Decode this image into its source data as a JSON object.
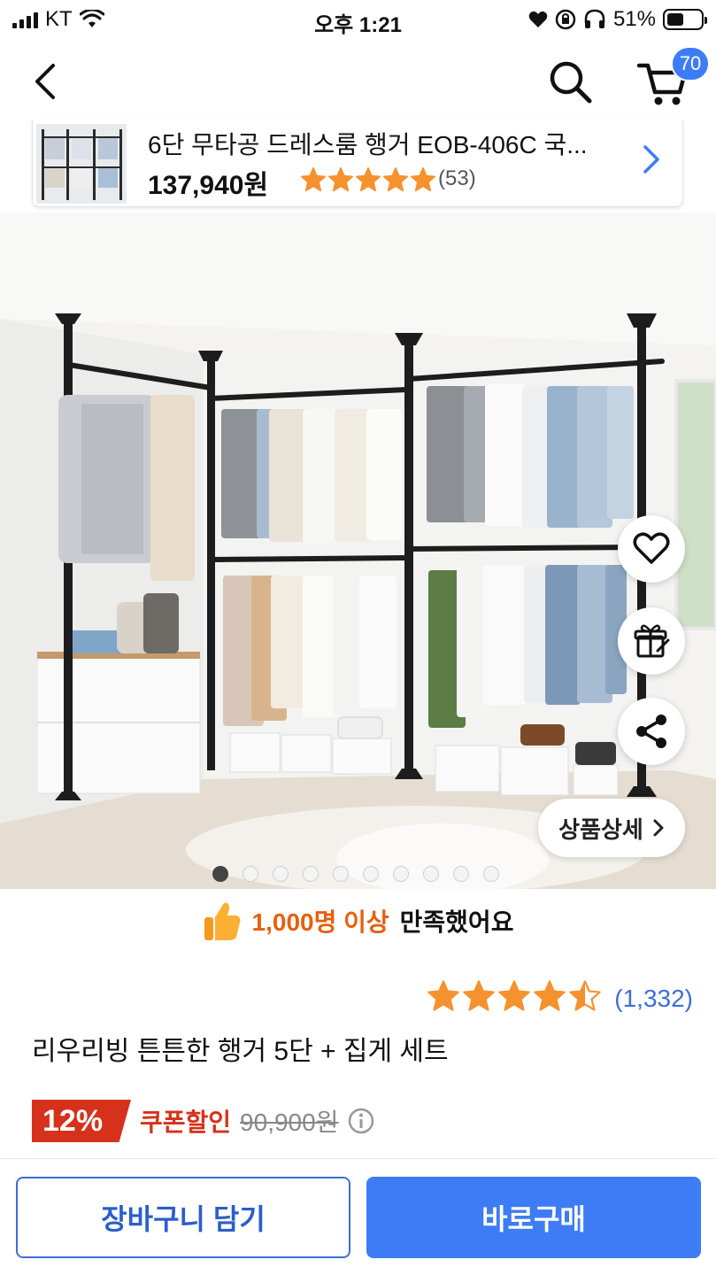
{
  "status_bar": {
    "carrier": "KT",
    "time": "오후 1:21",
    "battery_percent": "51%",
    "battery_level": 0.51
  },
  "header": {
    "back_icon": "chevron-left-icon",
    "search_icon": "search-icon",
    "cart_icon": "cart-icon",
    "cart_count": "70"
  },
  "recent_product": {
    "title": "6단 무타공 드레스룸 행거 EOB-406C 국...",
    "price": "137,940원",
    "rating_stars": 5,
    "review_count": "(53)"
  },
  "hero": {
    "page_indicator_total": 10,
    "page_indicator_active": 1,
    "detail_button_label": "상품상세",
    "action_icons": [
      "heart-icon",
      "gift-icon",
      "share-icon"
    ]
  },
  "satisfaction": {
    "highlight": "1,000명 이상",
    "text": "만족했어요"
  },
  "product": {
    "rating": 4.5,
    "review_count": "(1,332)",
    "title": "리우리빙 튼튼한 행거 5단 + 집게 세트",
    "discount": "12%",
    "coupon_label": "쿠폰할인",
    "original_price": "90,900원"
  },
  "bottom_bar": {
    "add_to_cart": "장바구니 담기",
    "buy_now": "바로구매"
  },
  "colors": {
    "accent_blue": "#3d7cf5",
    "discount_red": "#d6311b",
    "star_orange": "#f5922e",
    "highlight_orange": "#e5600e"
  }
}
